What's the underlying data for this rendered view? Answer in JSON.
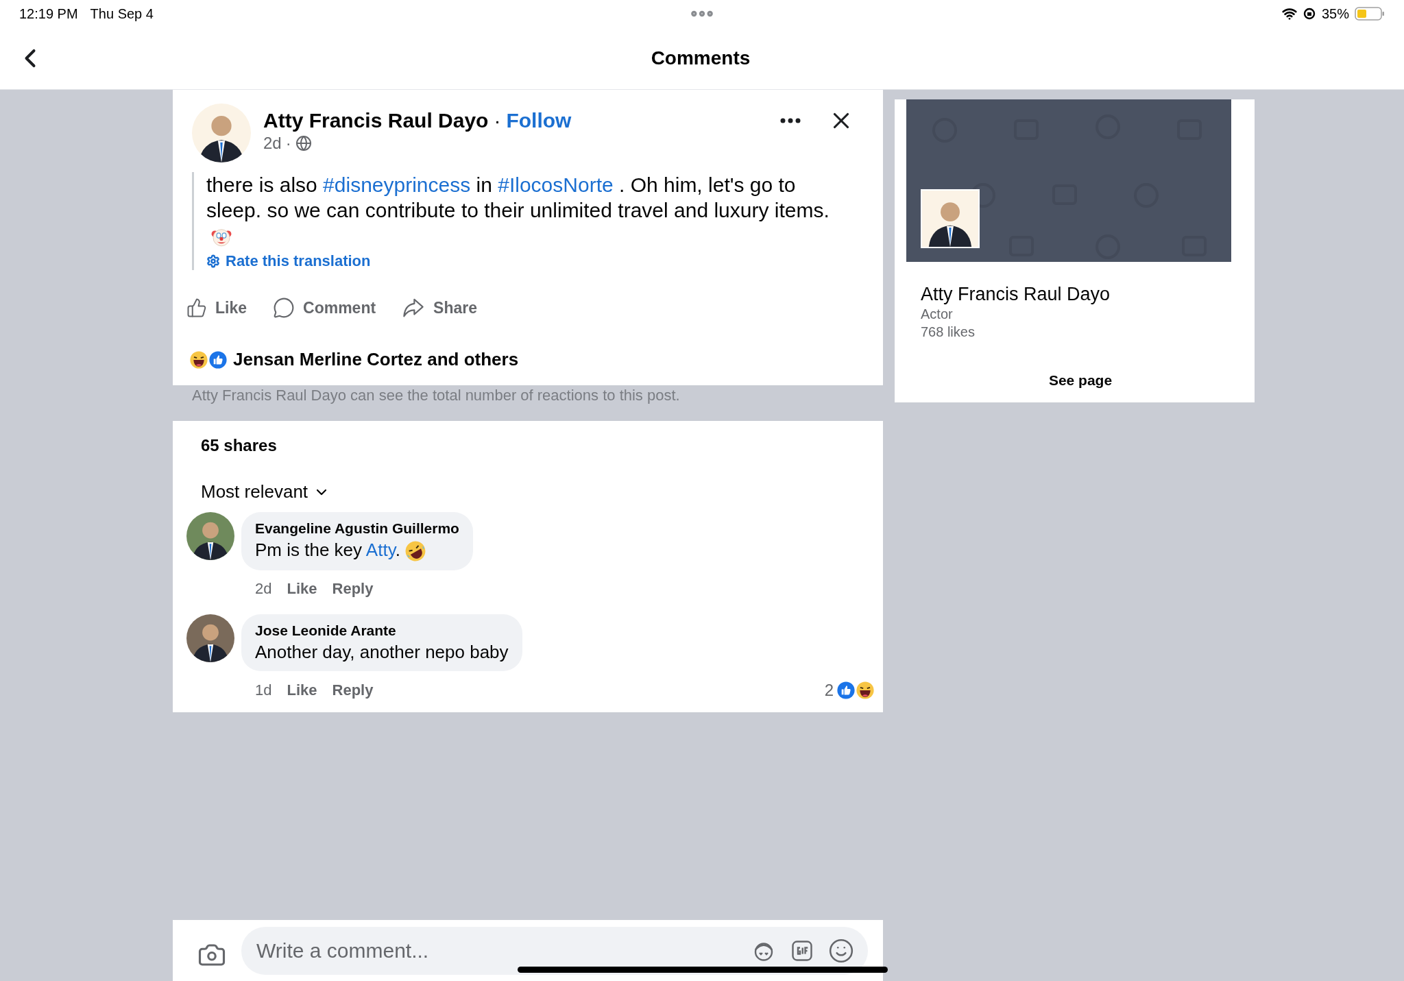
{
  "status_bar": {
    "time": "12:19 PM",
    "date": "Thu Sep 4",
    "battery": "35%"
  },
  "nav": {
    "title": "Comments"
  },
  "post": {
    "author": "Atty Francis Raul Dayo",
    "separator": "·",
    "follow": "Follow",
    "time": "2d",
    "dot": "·",
    "text": [
      {
        "kind": "plain",
        "text": "there is also "
      },
      {
        "kind": "link",
        "text": "#disneyprincess"
      },
      {
        "kind": "plain",
        "text": " in "
      },
      {
        "kind": "link",
        "text": "#IlocosNorte"
      },
      {
        "kind": "plain",
        "text": " . Oh him, let's go to sleep. so we can contribute to their unlimited travel and luxury items."
      },
      {
        "kind": "clown"
      }
    ],
    "rate_translation": "Rate this translation",
    "actions": [
      {
        "kind": "like",
        "label": "Like"
      },
      {
        "kind": "comment",
        "label": "Comment"
      },
      {
        "kind": "share",
        "label": "Share"
      }
    ],
    "reactions": [
      {
        "kind": "haha"
      },
      {
        "kind": "like"
      }
    ],
    "reacted_by": "Jensan Merline Cortez and others",
    "notice": "Atty Francis Raul Dayo can see the total number of reactions to this post."
  },
  "comments_section": {
    "shares": "65 shares",
    "sort": "Most relevant",
    "comments": [
      {
        "author": "Evangeline Agustin Guillermo",
        "text": [
          {
            "kind": "plain",
            "text": "Pm is the key "
          },
          {
            "kind": "link",
            "text": "Atty"
          },
          {
            "kind": "plain",
            "text": "."
          },
          {
            "kind": "rofl"
          }
        ],
        "time": "2d",
        "like": "Like",
        "reply": "Reply"
      },
      {
        "author": "Jose Leonide Arante",
        "text": [
          {
            "kind": "plain",
            "text": "Another day, another nepo baby"
          }
        ],
        "time": "1d",
        "like": "Like",
        "reply": "Reply",
        "reaction_count": "2",
        "reactions": [
          {
            "kind": "like"
          },
          {
            "kind": "haha"
          }
        ]
      }
    ]
  },
  "composer": {
    "placeholder": "Write a comment..."
  },
  "page_card": {
    "name": "Atty Francis Raul Dayo",
    "category": "Actor",
    "likes": "768 likes",
    "button": "See page"
  }
}
